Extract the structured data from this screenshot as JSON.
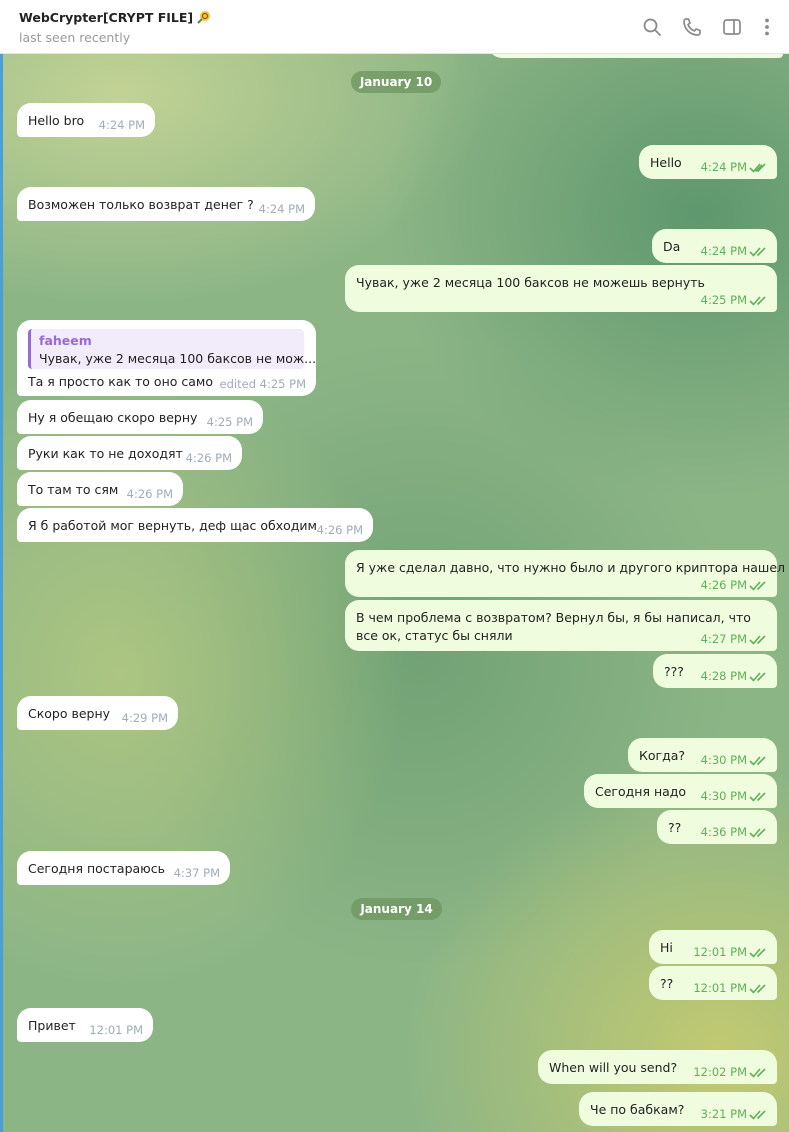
{
  "header": {
    "title": "WebCrypter[CRYPT FILE]",
    "status": "last seen recently",
    "icons": [
      "search-icon",
      "phone-icon",
      "sidebar-toggle-icon",
      "more-vertical-icon"
    ]
  },
  "colors": {
    "incoming": "#ffffff",
    "outgoing": "#effdde",
    "check": "#5faf58",
    "reply_accent": "#9a68d8"
  },
  "dates": [
    "January 10",
    "January 14"
  ],
  "messages": [
    {
      "text": "Hello bro",
      "time": "4:24 PM"
    },
    {
      "text": "Hello",
      "time": "4:24 PM"
    },
    {
      "text": "Возможен только возврат  денег ?",
      "time": "4:24 PM"
    },
    {
      "text": "Da",
      "time": "4:24 PM"
    },
    {
      "text": "Чувак, уже 2 месяца 100 баксов не можешь вернуть",
      "time": "4:25 PM"
    },
    {
      "text": "Та я просто как то оно само",
      "time": "edited 4:25 PM",
      "reply_name": "faheem",
      "reply_text": "Чувак, уже 2 месяца 100 баксов не мож..."
    },
    {
      "text": "Ну я обещаю скоро верну",
      "time": "4:25 PM"
    },
    {
      "text": "Руки как то не доходят",
      "time": "4:26 PM"
    },
    {
      "text": "То там то сям",
      "time": "4:26 PM"
    },
    {
      "text": "Я б работой мог вернуть, деф щас обходим",
      "time": "4:26 PM"
    },
    {
      "text": "Я уже сделал давно, что нужно было и другого криптора нашел",
      "time": "4:26 PM"
    },
    {
      "text": "В чем проблема с возвратом? Вернул бы, я бы написал, что все ок, статус бы сняли",
      "time": "4:27 PM"
    },
    {
      "text": "???",
      "time": "4:28 PM"
    },
    {
      "text": "Скоро верну",
      "time": "4:29 PM"
    },
    {
      "text": "Когда?",
      "time": "4:30 PM"
    },
    {
      "text": "Сегодня надо",
      "time": "4:30 PM"
    },
    {
      "text": "??",
      "time": "4:36 PM"
    },
    {
      "text": "Сегодня постараюсь",
      "time": "4:37 PM"
    },
    {
      "text": "Hi",
      "time": "12:01 PM"
    },
    {
      "text": "??",
      "time": "12:01 PM"
    },
    {
      "text": "Привет",
      "time": "12:01 PM"
    },
    {
      "text": "When will you send?",
      "time": "12:02 PM"
    },
    {
      "text": "Че по бабкам?",
      "time": "3:21 PM"
    }
  ]
}
